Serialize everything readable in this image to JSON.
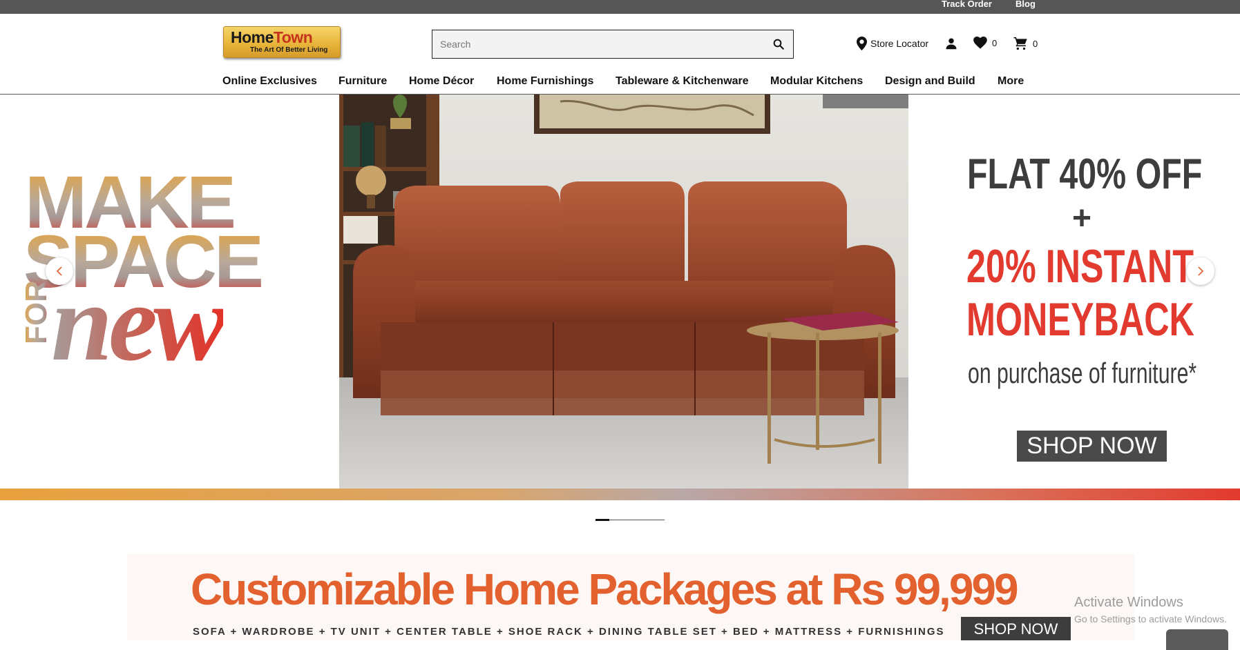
{
  "topbar": {
    "track_order": "Track Order",
    "blog": "Blog"
  },
  "logo": {
    "home": "Home",
    "town": "Town",
    "tagline": "The Art Of Better Living"
  },
  "search": {
    "placeholder": "Search",
    "value": ""
  },
  "header": {
    "store_locator": "Store Locator",
    "wishlist_count": "0",
    "cart_count": "0"
  },
  "nav": {
    "items": [
      "Online Exclusives",
      "Furniture",
      "Home Décor",
      "Home Furnishings",
      "Tableware & Kitchenware",
      "Modular Kitchens",
      "Design and Build",
      "More"
    ]
  },
  "hero": {
    "left": {
      "make": "MAKE",
      "space": "SPACE",
      "for": "FOR",
      "new": "new"
    },
    "right": {
      "line1": "FLAT 40% OFF",
      "plus": "+",
      "line2": "20% INSTANT",
      "line3": "MONEYBACK",
      "line4": "on purchase of furniture*",
      "cta": "SHOP NOW"
    },
    "carousel": {
      "slide": 1,
      "total": 5
    }
  },
  "package_banner": {
    "title": "Customizable Home Packages at Rs 99,999",
    "subtitle": "SOFA + WARDROBE + TV UNIT + CENTER TABLE + SHOE RACK + DINING TABLE SET + BED + MATTRESS + FURNISHINGS",
    "cta": "SHOP NOW"
  },
  "watermark": {
    "line1": "Activate Windows",
    "line2": "Go to Settings to activate Windows."
  },
  "colors": {
    "accent_red": "#e23a2e",
    "accent_orange": "#e3612e",
    "dark_gray": "#3d3d3d"
  },
  "icons": [
    "search-icon",
    "location-pin-icon",
    "user-icon",
    "heart-icon",
    "cart-icon",
    "chevron-left-icon",
    "chevron-right-icon"
  ]
}
